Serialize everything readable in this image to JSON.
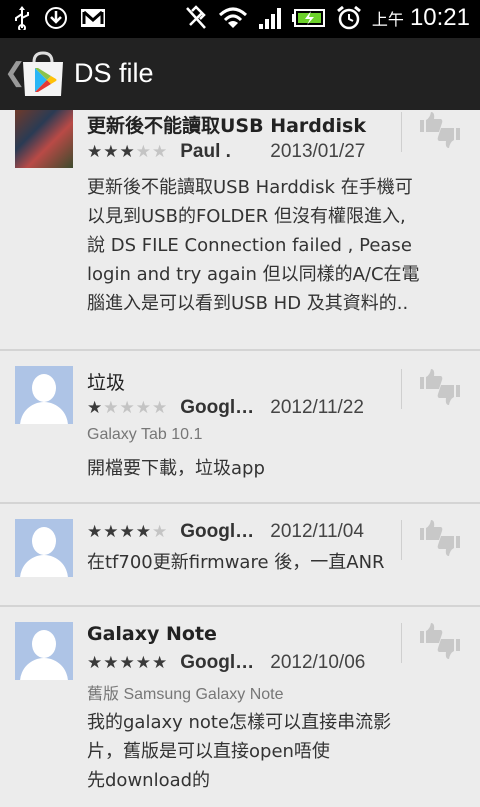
{
  "statusbar": {
    "icons": [
      "usb-icon",
      "download-icon",
      "gmail-icon",
      "vibrate-off-icon",
      "wifi-icon",
      "signal-icon",
      "battery-icon",
      "alarm-icon"
    ],
    "ampm": "上午",
    "time": "10:21"
  },
  "actionbar": {
    "back_glyph": "❮",
    "title": "DS file"
  },
  "colors": {
    "background": "#ececec",
    "actionbar": "#222222",
    "star_on": "#3a3a3a",
    "star_off": "#c4c4c4",
    "avatar_placeholder": "#aec4e6"
  },
  "reviews": [
    {
      "title": "更新後不能讀取USB Harddisk",
      "rating": 3,
      "author": "Paul .",
      "date": "2013/01/27",
      "device": "",
      "body": [
        "更新後不能讀取USB Harddisk 在手機可",
        "以見到USB的FOLDER 但沒有權限進入,",
        "說 DS FILE Connection failed , Pease",
        "login and try again  但以同樣的A/C在電",
        "腦進入是可以看到USB HD 及其資料的.."
      ]
    },
    {
      "title": "垃圾",
      "rating": 1,
      "author": "Googl…",
      "date": "2012/11/22",
      "device": "Galaxy Tab 10.1",
      "body": [
        "開檔要下載，垃圾app"
      ]
    },
    {
      "title": "",
      "rating": 4,
      "author": "Googl…",
      "date": "2012/11/04",
      "device": "",
      "body": [
        "在tf700更新firmware 後，一直ANR"
      ]
    },
    {
      "title": "Galaxy Note",
      "rating": 5,
      "author": "Googl…",
      "date": "2012/10/06",
      "device": "舊版 Samsung Galaxy Note",
      "body": [
        "我的galaxy note怎樣可以直接串流影",
        "片，舊版是可以直接open唔使",
        "先download的"
      ]
    }
  ]
}
